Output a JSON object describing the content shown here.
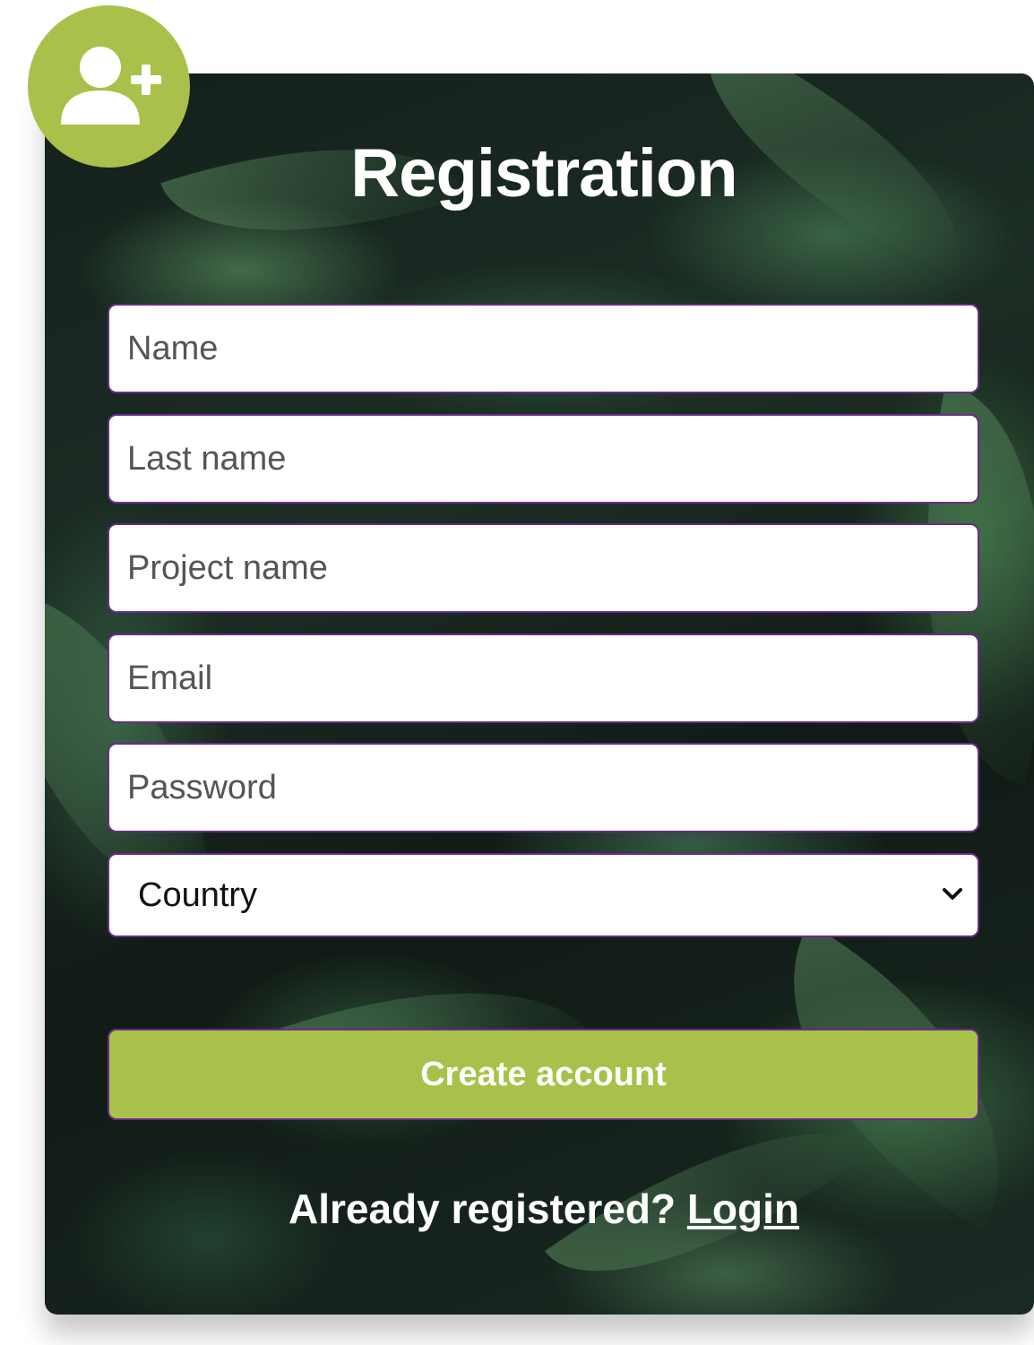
{
  "form": {
    "title": "Registration",
    "fields": [
      {
        "placeholder": "Name"
      },
      {
        "placeholder": "Last name"
      },
      {
        "placeholder": "Project name"
      },
      {
        "placeholder": "Email"
      },
      {
        "placeholder": "Password"
      }
    ],
    "country_select": {
      "selected": "Country"
    },
    "submit_label": "Create account",
    "footer_text": "Already registered?",
    "login_label": "Login"
  },
  "colors": {
    "accent": "#a9c14a",
    "field_border": "#6a2a8c",
    "text_on_dark": "#ffffff"
  },
  "icons": {
    "avatar": "user-plus-icon",
    "select": "chevron-down-icon"
  }
}
